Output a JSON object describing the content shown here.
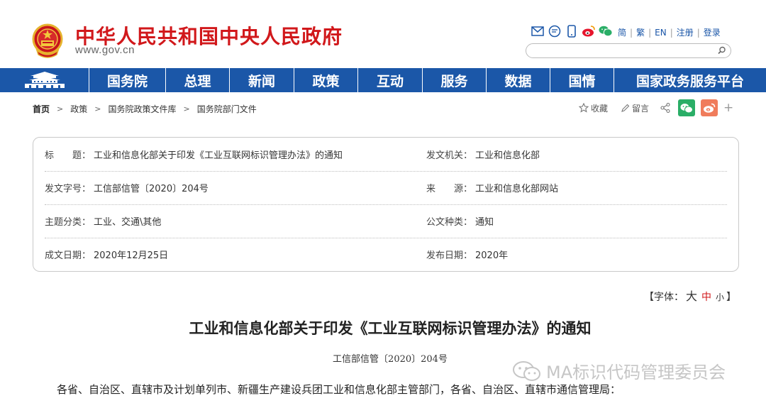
{
  "header": {
    "site_title": "中华人民共和国中央人民政府",
    "site_url": "www.gov.cn",
    "top_icons": [
      "mail-icon",
      "message-icon",
      "mobile-icon",
      "weibo-icon",
      "wechat-icon"
    ],
    "top_links": [
      "简",
      "繁",
      "EN",
      "注册",
      "登录"
    ],
    "search_placeholder": "",
    "brand_color": "#d1181b"
  },
  "nav": {
    "background": "#1b57a8",
    "items": [
      "国务院",
      "总理",
      "新闻",
      "政策",
      "互动",
      "服务",
      "数据",
      "国情",
      "国家政务服务平台"
    ]
  },
  "breadcrumb": [
    "首页",
    "政策",
    "国务院政策文件库",
    "国务院部门文件"
  ],
  "share": {
    "favorite": "收藏",
    "comment": "留言",
    "icons": [
      "share-icon",
      "wechat-share-icon",
      "weibo-share-icon",
      "more-icon"
    ]
  },
  "info": {
    "rows": [
      {
        "label1": "标　　题：",
        "value1": "工业和信息化部关于印发《工业互联网标识管理办法》的通知",
        "label2": "发文机关：",
        "value2": "工业和信息化部"
      },
      {
        "label1": "发文字号：",
        "value1": "工信部信管〔2020〕204号",
        "label2": "来　　源：",
        "value2": "工业和信息化部网站"
      },
      {
        "label1": "主题分类：",
        "value1": "工业、交通\\其他",
        "label2": "公文种类：",
        "value2": "通知"
      },
      {
        "label1": "成文日期：",
        "value1": "2020年12月25日",
        "label2": "发布日期：",
        "value2": "2020年"
      }
    ]
  },
  "font_size": {
    "open": "【字体：",
    "large": "大",
    "medium": "中",
    "small": "小",
    "close": "】",
    "active_color": "#d1181b"
  },
  "article": {
    "title": "工业和信息化部关于印发《工业互联网标识管理办法》的通知",
    "doc_number": "工信部信管〔2020〕204号",
    "first_line": "各省、自治区、直辖市及计划单列市、新疆生产建设兵团工业和信息化部主管部门，各省、自治区、直辖市通信管理局："
  },
  "watermark": {
    "text": "MA标识代码管理委员会",
    "icon": "wechat-icon"
  }
}
